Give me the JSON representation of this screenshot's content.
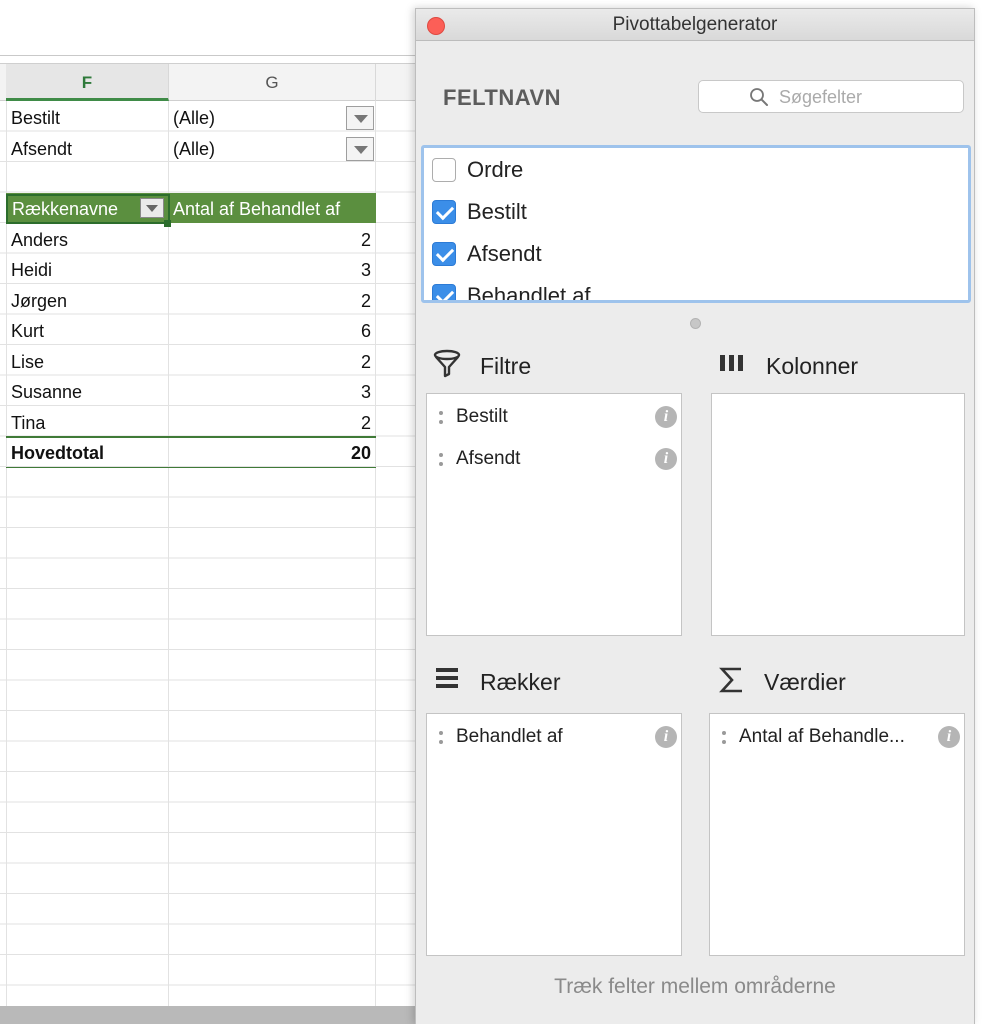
{
  "sheet": {
    "columns": [
      {
        "letter": "F",
        "active": true
      },
      {
        "letter": "G",
        "active": false
      }
    ],
    "filters": [
      {
        "field": "Bestilt",
        "value": "(Alle)"
      },
      {
        "field": "Afsendt",
        "value": "(Alle)"
      }
    ],
    "pivot": {
      "row_header": "Rækkenavne",
      "value_header": "Antal af Behandlet af",
      "rows": [
        {
          "name": "Anders",
          "count": "2"
        },
        {
          "name": "Heidi",
          "count": "3"
        },
        {
          "name": "Jørgen",
          "count": "2"
        },
        {
          "name": "Kurt",
          "count": "6"
        },
        {
          "name": "Lise",
          "count": "2"
        },
        {
          "name": "Susanne",
          "count": "3"
        },
        {
          "name": "Tina",
          "count": "2"
        }
      ],
      "total_label": "Hovedtotal",
      "total_value": "20"
    }
  },
  "panel": {
    "title": "Pivottabelgenerator",
    "fields_heading": "FELTNAVN",
    "search_placeholder": "Søgefelter",
    "fields": [
      {
        "label": "Ordre",
        "checked": false
      },
      {
        "label": "Bestilt",
        "checked": true
      },
      {
        "label": "Afsendt",
        "checked": true
      },
      {
        "label": "Behandlet af",
        "checked": true
      }
    ],
    "areas": {
      "filters": {
        "title": "Filtre",
        "icon": "funnel-icon",
        "items": [
          "Bestilt",
          "Afsendt"
        ]
      },
      "columns": {
        "title": "Kolonner",
        "icon": "columns-icon",
        "items": []
      },
      "rows": {
        "title": "Rækker",
        "icon": "rows-icon",
        "items": [
          "Behandlet af"
        ]
      },
      "values": {
        "title": "Værdier",
        "icon": "sigma-icon",
        "items": [
          "Antal af Behandle..."
        ]
      }
    },
    "footer_hint": "Træk felter mellem områderne",
    "colors": {
      "accent": "#3b8ee8",
      "pivot_green": "#5b8f3f",
      "close": "#fc5f57"
    }
  }
}
